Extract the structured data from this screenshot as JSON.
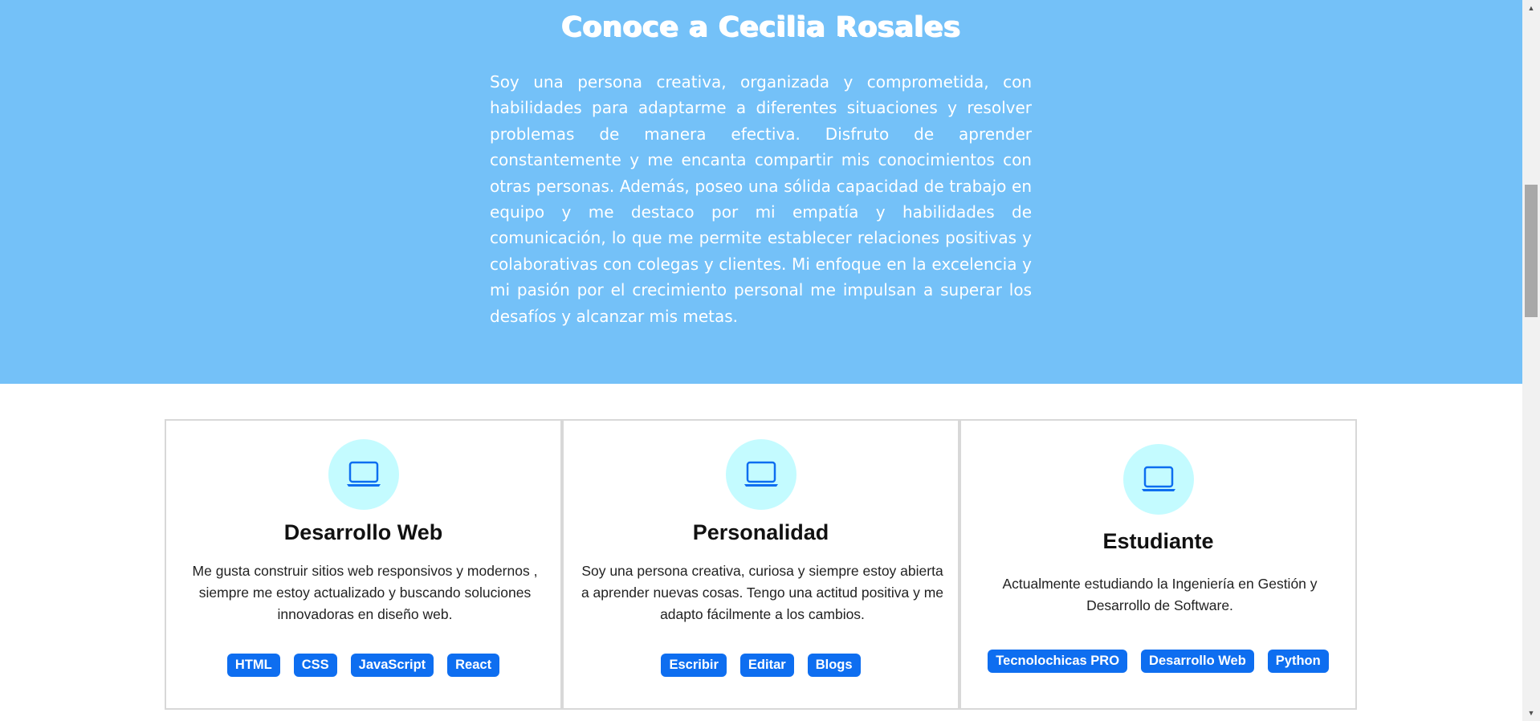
{
  "hero": {
    "title": "Conoce a Cecilia Rosales",
    "text": "Soy una persona creativa, organizada y comprometida, con habilidades para adaptarme a diferentes situaciones y resolver problemas de manera efectiva. Disfruto de aprender constantemente y me encanta compartir mis conocimientos con otras personas. Además, poseo una sólida capacidad de trabajo en equipo y me destaco por mi empatía y habilidades de comunicación, lo que me permite establecer relaciones positivas y colaborativas con colegas y clientes. Mi enfoque en la excelencia y mi pasión por el crecimiento personal me impulsan a superar los desafíos y alcanzar mis metas."
  },
  "cards": [
    {
      "icon": "laptop-icon",
      "title": "Desarrollo Web",
      "description": "Me gusta construir sitios web responsivos y modernos , siempre me estoy actualizado y buscando soluciones innovadoras en diseño web.",
      "tags": [
        "HTML",
        "CSS",
        "JavaScript",
        "React"
      ]
    },
    {
      "icon": "laptop-icon",
      "title": "Personalidad",
      "description": "Soy una persona creativa, curiosa y siempre estoy abierta a aprender nuevas cosas. Tengo una actitud positiva y me adapto fácilmente a los cambios.",
      "tags": [
        "Escribir",
        "Editar",
        "Blogs"
      ]
    },
    {
      "icon": "laptop-icon",
      "title": "Estudiante",
      "description": "Actualmente estudiando la Ingeniería en Gestión y Desarrollo de Software.",
      "tags": [
        "Tecnolochicas PRO",
        "Desarrollo Web",
        "Python"
      ]
    }
  ],
  "colors": {
    "hero_bg": "#74c1f8",
    "icon_circle": "#c4fbff",
    "icon_stroke": "#0e6ef0",
    "tag_bg": "#0e6ef0"
  }
}
